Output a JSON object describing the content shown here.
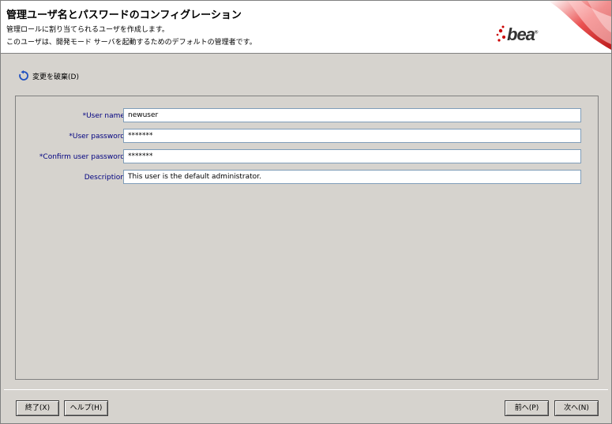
{
  "header": {
    "title": "管理ユーザ名とパスワードのコンフィグレーション",
    "line1": "管理ロールに割り当てられるユーザを作成します。",
    "line2": "このユーザは、開発モード サーバを起動するためのデフォルトの管理者です。",
    "logo": "bea"
  },
  "discard": {
    "label": "変更を破棄(D)",
    "icon": "undo-refresh-icon"
  },
  "form": {
    "fields": [
      {
        "label": "*User name:",
        "value": "newuser"
      },
      {
        "label": "*User password:",
        "value": "*******"
      },
      {
        "label": "*Confirm user password:",
        "value": "*******"
      },
      {
        "label": "Description:",
        "value": "This user is the default administrator."
      }
    ]
  },
  "buttons": {
    "exit": "終了(X)",
    "help": "ヘルプ(H)",
    "prev": "前へ(P)",
    "next": "次へ(N)"
  },
  "colors": {
    "label": "#000080",
    "background": "#d6d3ce",
    "logo_red": "#cc0000"
  }
}
